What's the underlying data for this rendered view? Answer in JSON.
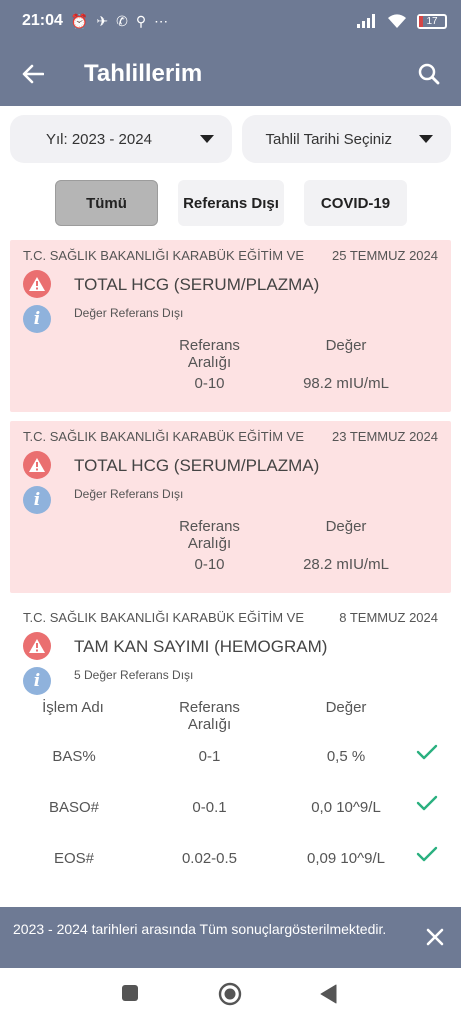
{
  "status": {
    "time": "21:04",
    "icons": [
      "⏰",
      "✈",
      "✆",
      "⚲",
      "⋯"
    ],
    "battery": "17"
  },
  "appbar": {
    "title": "Tahlillerim"
  },
  "filters": {
    "year": "Yıl: 2023 - 2024",
    "date": "Tahlil Tarihi Seçiniz"
  },
  "tabs": [
    "Tümü",
    "Referans Dışı",
    "COVID-19"
  ],
  "headers": {
    "name": "İşlem Adı",
    "ref": "Referans Aralığı",
    "value": "Değer"
  },
  "cards": [
    {
      "institution": "T.C. SAĞLIK BAKANLIĞI KARABÜK EĞİTİM VE",
      "date": "25 TEMMUZ 2024",
      "test": "TOTAL HCG (SERUM/PLAZMA)",
      "note": "Değer Referans Dışı",
      "ref": "0-10",
      "value": "98.2 mIU/mL"
    },
    {
      "institution": "T.C. SAĞLIK BAKANLIĞI KARABÜK EĞİTİM VE",
      "date": "23 TEMMUZ 2024",
      "test": "TOTAL HCG (SERUM/PLAZMA)",
      "note": "Değer Referans Dışı",
      "ref": "0-10",
      "value": "28.2 mIU/mL"
    },
    {
      "institution": "T.C. SAĞLIK BAKANLIĞI KARABÜK EĞİTİM VE",
      "date": "8 TEMMUZ 2024",
      "test": "TAM KAN SAYIMI (HEMOGRAM)",
      "note": "5 Değer Referans Dışı",
      "rows": [
        {
          "name": "BAS%",
          "ref": "0-1",
          "value": "0,5 %"
        },
        {
          "name": "BASO#",
          "ref": "0-0.1",
          "value": "0,0 10^9/L"
        },
        {
          "name": "EOS#",
          "ref": "0.02-0.5",
          "value": "0,09 10^9/L"
        }
      ]
    }
  ],
  "toast": {
    "message": "2023 - 2024 tarihleri arasında Tüm sonuçlargösterilmektedir."
  },
  "colors": {
    "appbar": "#6e7a94",
    "alert": "#ea6f70",
    "info": "#8fb2dc",
    "card_warn": "#fde2e3",
    "check": "#2ab07f"
  }
}
